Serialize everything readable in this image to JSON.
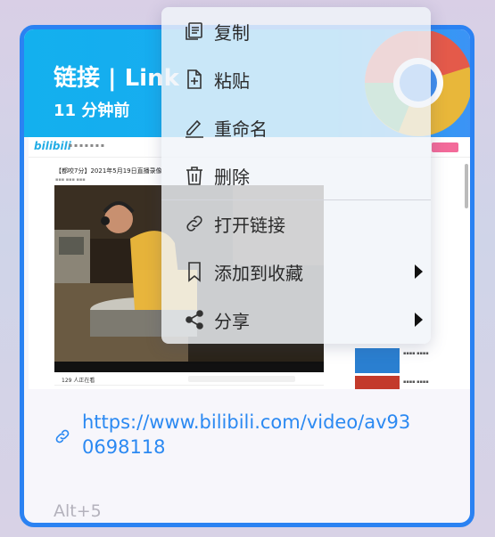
{
  "card": {
    "title": "链接 | Link",
    "time": "11 分钟前",
    "url": "https://www.bilibili.com/video/av930698118",
    "shortcut": "Alt+5"
  },
  "preview": {
    "site_logo": "bilibili",
    "video_title": "【都咬7分】2021年5月19日直播录像",
    "comment_count": "129 人正在看"
  },
  "menu": {
    "items": [
      {
        "label": "复制",
        "icon": "copy-icon"
      },
      {
        "label": "粘贴",
        "icon": "paste-icon"
      },
      {
        "label": "重命名",
        "icon": "rename-icon"
      },
      {
        "label": "删除",
        "icon": "delete-icon"
      },
      {
        "label": "打开链接",
        "icon": "link-icon"
      },
      {
        "label": "添加到收藏",
        "icon": "bookmark-icon",
        "submenu": true
      },
      {
        "label": "分享",
        "icon": "share-icon",
        "submenu": true
      }
    ]
  },
  "colors": {
    "accent": "#2b82f2",
    "header": "#13b0ee",
    "link": "#2b89f2"
  }
}
